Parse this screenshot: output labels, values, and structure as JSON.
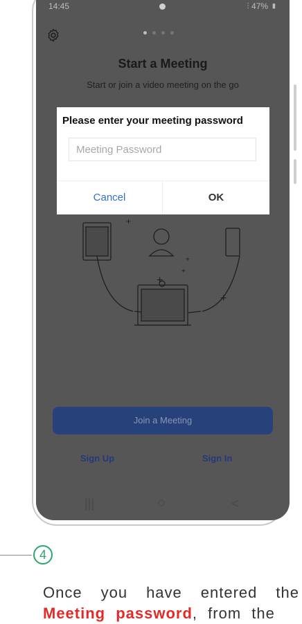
{
  "status_bar": {
    "time": "14:45",
    "battery": "47%"
  },
  "page": {
    "title": "Start a Meeting",
    "subtitle": "Start or join a video meeting on the go"
  },
  "dialog": {
    "title": "Please enter your meeting password",
    "placeholder": "Meeting Password",
    "cancel_label": "Cancel",
    "ok_label": "OK"
  },
  "actions": {
    "join_label": "Join a Meeting",
    "sign_up_label": "Sign Up",
    "sign_in_label": "Sign In"
  },
  "nav": {
    "recents": "|||",
    "home": "○",
    "back": "<"
  },
  "step": {
    "number": "4",
    "text_before": "Once you have entered the",
    "highlight": "Meeting password",
    "text_after": ", from the"
  },
  "colors": {
    "accent_green": "#2ea56a",
    "highlight_red": "#e32a2a",
    "join_button": "#27427a"
  }
}
